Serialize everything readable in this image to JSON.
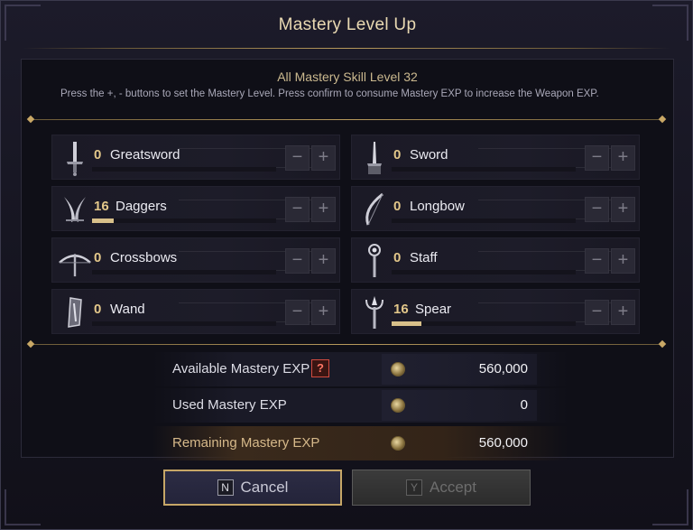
{
  "title": "Mastery Level Up",
  "subtitle": "All Mastery Skill Level 32",
  "description": "Press the +, - buttons to set the Mastery Level. Press confirm to consume Mastery EXP to increase the Weapon EXP.",
  "weapons": [
    {
      "level": "0",
      "name": "Greatsword",
      "icon": "greatsword-icon",
      "progress": 0
    },
    {
      "level": "0",
      "name": "Sword",
      "icon": "sword-icon",
      "progress": 0
    },
    {
      "level": "16",
      "name": "Daggers",
      "icon": "daggers-icon",
      "progress": 0.12
    },
    {
      "level": "0",
      "name": "Longbow",
      "icon": "longbow-icon",
      "progress": 0
    },
    {
      "level": "0",
      "name": "Crossbows",
      "icon": "crossbow-icon",
      "progress": 0
    },
    {
      "level": "0",
      "name": "Staff",
      "icon": "staff-icon",
      "progress": 0
    },
    {
      "level": "0",
      "name": "Wand",
      "icon": "wand-icon",
      "progress": 0
    },
    {
      "level": "16",
      "name": "Spear",
      "icon": "spear-icon",
      "progress": 0.16
    }
  ],
  "buttons": {
    "minus": "−",
    "plus": "+"
  },
  "exp": {
    "available_label": "Available Mastery EXP",
    "available_value": "560,000",
    "help": "?",
    "used_label": "Used Mastery EXP",
    "used_value": "0",
    "remaining_label": "Remaining Mastery EXP",
    "remaining_value": "560,000"
  },
  "actions": {
    "cancel_key": "N",
    "cancel_label": "Cancel",
    "accept_key": "Y",
    "accept_label": "Accept"
  },
  "colors": {
    "accent": "#c7a767",
    "level": "#e3c78a",
    "warning": "#d24b3f"
  }
}
